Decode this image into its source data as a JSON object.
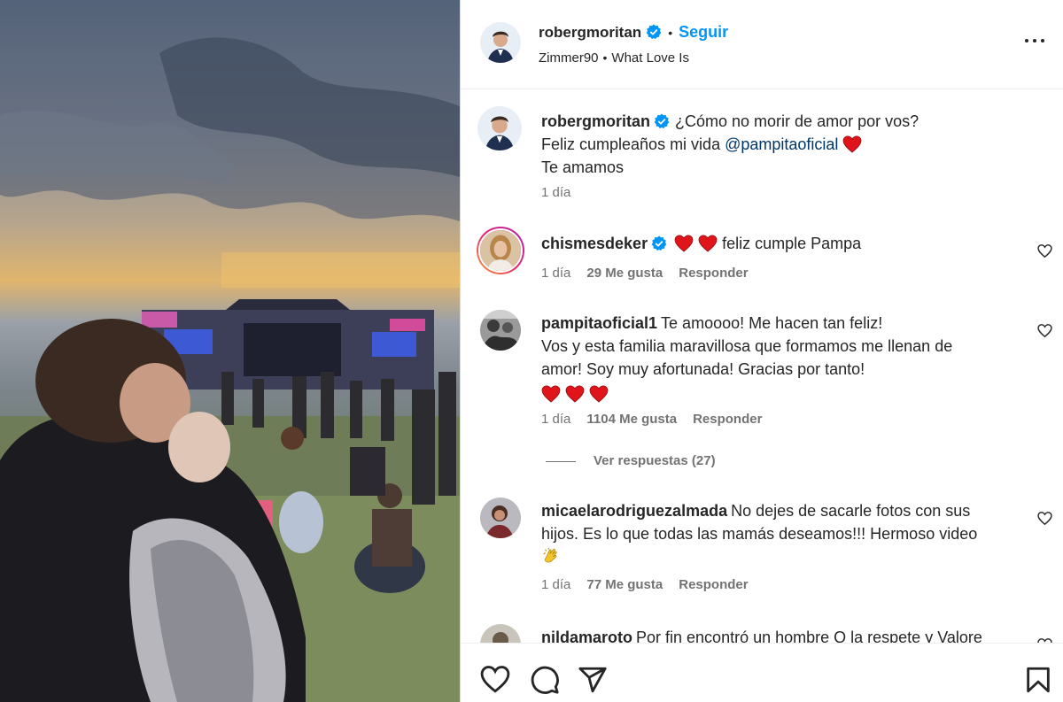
{
  "header": {
    "username": "robergmoritan",
    "follow_label": "Seguir",
    "audio_artist": "Zimmer90",
    "audio_song": "What Love Is"
  },
  "caption": {
    "username": "robergmoritan",
    "line1": "¿Cómo no morir de amor por vos?",
    "line2_prefix": "Feliz cumpleaños mi vida",
    "mention": "@pampitaoficial",
    "line3": "Te amamos",
    "time": "1 día"
  },
  "comments": [
    {
      "username": "chismesdeker",
      "text": "feliz cumple Pampa",
      "time": "1 día",
      "likes": "29 Me gusta",
      "reply": "Responder"
    },
    {
      "username": "pampitaoficial1",
      "text_line1": "Te amoooo! Me hacen tan feliz!",
      "text_line2": "Vos y esta familia maravillosa que formamos me llenan de",
      "text_line3": "amor! Soy muy afortunada! Gracias por tanto!",
      "time": "1 día",
      "likes": "1104 Me gusta",
      "reply": "Responder",
      "view_replies": "Ver respuestas (27)"
    },
    {
      "username": "micaelarodriguezalmada",
      "text_line1": "No dejes de sacarle fotos con sus",
      "text_line2": "hijos. Es lo que todas las mamás deseamos!!! Hermoso video",
      "time": "1 día",
      "likes": "77 Me gusta",
      "reply": "Responder"
    },
    {
      "username": "nildamaroto",
      "text": "Por fin encontró un hombre Q la respete y Valore"
    }
  ],
  "icons": [
    "verified-icon",
    "more-options-icon",
    "like-heart-icon",
    "comment-icon",
    "share-icon",
    "save-icon",
    "red-heart-emoji",
    "clapping-hands-emoji"
  ],
  "colors": {
    "accent": "#0095f6",
    "text": "#262626",
    "muted": "#737373",
    "heart": "#e0151b"
  }
}
